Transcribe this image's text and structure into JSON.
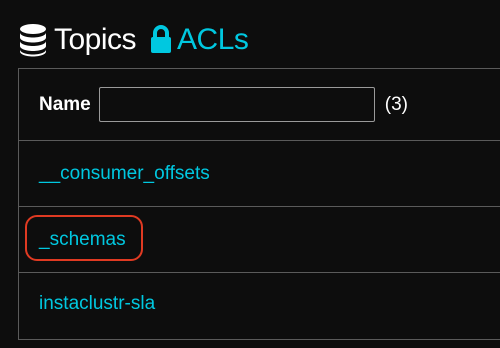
{
  "header": {
    "topics_tab": {
      "label": "Topics",
      "icon": "database-icon"
    },
    "acls_tab": {
      "label": "ACLs",
      "icon": "lock-icon"
    }
  },
  "filter": {
    "label": "Name",
    "value": "",
    "placeholder": "",
    "count": "(3)"
  },
  "topics": [
    {
      "name": "__consumer_offsets",
      "highlighted": false
    },
    {
      "name": "_schemas",
      "highlighted": true
    },
    {
      "name": "instaclustr-sla",
      "highlighted": false
    }
  ],
  "colors": {
    "background": "#0d0d0d",
    "link": "#00c8e0",
    "border": "#5a5a5a",
    "highlight": "#e03a22"
  }
}
